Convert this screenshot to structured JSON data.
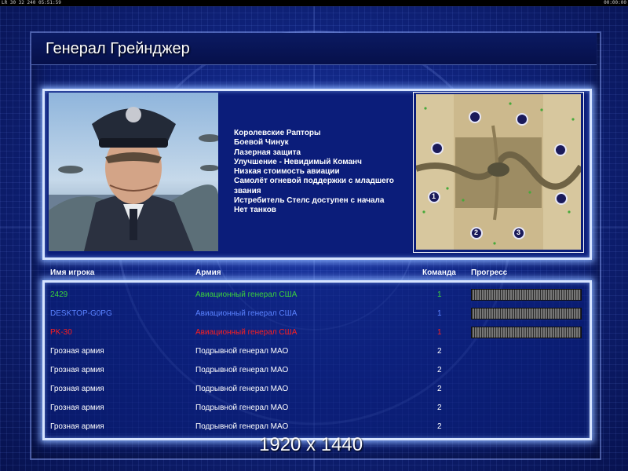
{
  "topbar": {
    "left_text": "LR 30 32 240 05:51:59",
    "right_text": "00:00:00"
  },
  "title": "Генерал Грейнджер",
  "features": [
    "Королевские Рапторы",
    "Боевой Чинук",
    "Лазерная защита",
    "Улучшение - Невидимый Команч",
    "Низкая стоимость авиации",
    "Самолёт огневой поддержки с младшего",
    " звания",
    "Истребитель Стелс доступен с начала",
    "Нет танков"
  ],
  "columns": {
    "player": "Имя игрока",
    "army": "Армия",
    "team": "Команда",
    "progress": "Прогресс"
  },
  "players": [
    {
      "name": "2429",
      "army": "Авиационный генерал США",
      "team": "1",
      "color": "#3bd23b",
      "progress": 1.0
    },
    {
      "name": "DESKTOP-G0PG",
      "army": "Авиационный генерал США",
      "team": "1",
      "color": "#5a82ff",
      "progress": 1.0
    },
    {
      "name": "PK-30",
      "army": "Авиационный генерал США",
      "team": "1",
      "color": "#ff1e1e",
      "progress": 1.0
    },
    {
      "name": "Грозная армия",
      "army": "Подрывной генерал МАО",
      "team": "2",
      "color": "#ffffff"
    },
    {
      "name": "Грозная армия",
      "army": "Подрывной генерал МАО",
      "team": "2",
      "color": "#ffffff"
    },
    {
      "name": "Грозная армия",
      "army": "Подрывной генерал МАО",
      "team": "2",
      "color": "#ffffff"
    },
    {
      "name": "Грозная армия",
      "army": "Подрывной генерал МАО",
      "team": "2",
      "color": "#ffffff"
    },
    {
      "name": "Грозная армия",
      "army": "Подрывной генерал МАО",
      "team": "2",
      "color": "#ffffff"
    }
  ],
  "minimap": {
    "labels": [
      "1",
      "2",
      "3"
    ]
  },
  "resolution": "1920 x 1440"
}
